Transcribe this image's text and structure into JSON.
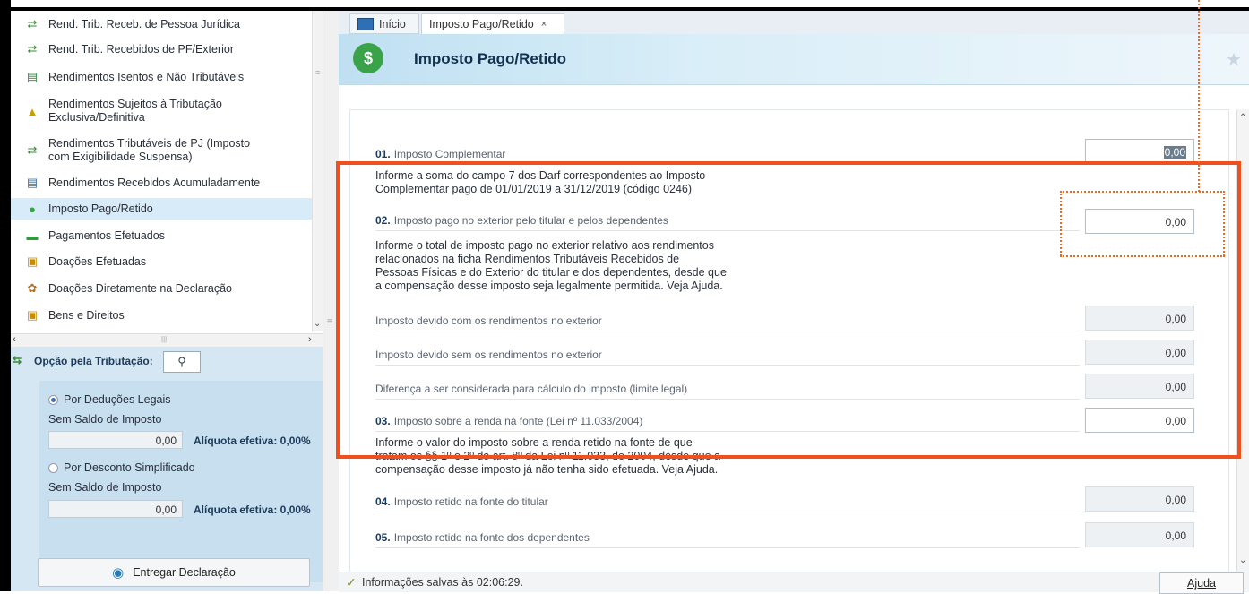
{
  "sidebar": {
    "items": [
      {
        "label": "Rend. Trib. Receb. de Pessoa Jurídica",
        "icon": "transfer-pj-icon"
      },
      {
        "label": "Rend. Trib. Recebidos de PF/Exterior",
        "icon": "transfer-pf-icon"
      },
      {
        "label": "Rendimentos Isentos e Não Tributáveis",
        "icon": "document-check-icon"
      },
      {
        "label": "Rendimentos Sujeitos à Tributação Exclusiva/Definitiva",
        "icon": "document-warning-icon"
      },
      {
        "label": "Rendimentos Tributáveis de PJ (Imposto com Exigibilidade Suspensa)",
        "icon": "transfer-suspended-icon"
      },
      {
        "label": "Rendimentos Recebidos Acumuladamente",
        "icon": "document-search-icon"
      },
      {
        "label": "Imposto Pago/Retido",
        "icon": "money-hand-icon"
      },
      {
        "label": "Pagamentos Efetuados",
        "icon": "card-icon"
      },
      {
        "label": "Doações Efetuadas",
        "icon": "donation-icon"
      },
      {
        "label": "Doações Diretamente na Declaração",
        "icon": "people-icon"
      },
      {
        "label": "Bens e Direitos",
        "icon": "assets-icon"
      }
    ],
    "opcao": {
      "title": "Opção pela Tributação:",
      "deducoes_label": "Por Deduções Legais",
      "deducoes_status": "Sem Saldo de Imposto",
      "deducoes_value": "0,00",
      "deducoes_aliquota": "Alíquota efetiva: 0,00%",
      "simplificado_label": "Por Desconto Simplificado",
      "simplificado_status": "Sem Saldo de Imposto",
      "simplificado_value": "0,00",
      "simplificado_aliquota": "Alíquota efetiva: 0,00%"
    },
    "entregar_label": "Entregar Declaração"
  },
  "tabs": {
    "inicio": "Início",
    "active": "Imposto Pago/Retido",
    "close": "×"
  },
  "header": {
    "title": "Imposto Pago/Retido"
  },
  "form": {
    "r01": {
      "num": "01.",
      "label": "Imposto Complementar",
      "value": "0,00",
      "help1": "Informe a soma do campo 7 dos Darf correspondentes ao Imposto",
      "help2": "Complementar pago de 01/01/2019 a 31/12/2019 (código 0246)"
    },
    "r02": {
      "num": "02.",
      "label": "Imposto pago no exterior pelo titular e pelos dependentes",
      "value": "0,00",
      "help1": "Informe o total de imposto pago no exterior relativo aos rendimentos",
      "help2": "relacionados na ficha Rendimentos Tributáveis Recebidos de",
      "help3": "Pessoas Físicas e do Exterior do titular e dos dependentes, desde que",
      "help4": "a compensação desse imposto seja legalmente permitida. Veja Ajuda."
    },
    "devido_com": {
      "label": "Imposto devido com os rendimentos no exterior",
      "value": "0,00"
    },
    "devido_sem": {
      "label": "Imposto devido sem os rendimentos no exterior",
      "value": "0,00"
    },
    "diferenca": {
      "label": "Diferença a ser considerada para cálculo do imposto (limite legal)",
      "value": "0,00"
    },
    "r03": {
      "num": "03.",
      "label": "Imposto sobre a renda na fonte (Lei nº 11.033/2004)",
      "value": "0,00",
      "help1": "Informe o valor do imposto sobre a renda retido na fonte de que",
      "help2": "tratam os §§ 1º e 2º do art. 8º da Lei nº 11.033, de 2004, desde que a",
      "help3": "compensação desse imposto já não tenha sido efetuada. Veja Ajuda."
    },
    "r04": {
      "num": "04.",
      "label": "Imposto retido na fonte do titular",
      "value": "0,00"
    },
    "r05": {
      "num": "05.",
      "label": "Imposto retido na fonte dos dependentes",
      "value": "0,00"
    }
  },
  "status": {
    "text": "Informações salvas às 02:06:29.",
    "help_button": "Ajuda"
  },
  "colors": {
    "annotation": "#f0501e",
    "header_bg": "#bfe0f2",
    "selected_item": "#d7ecf8"
  }
}
